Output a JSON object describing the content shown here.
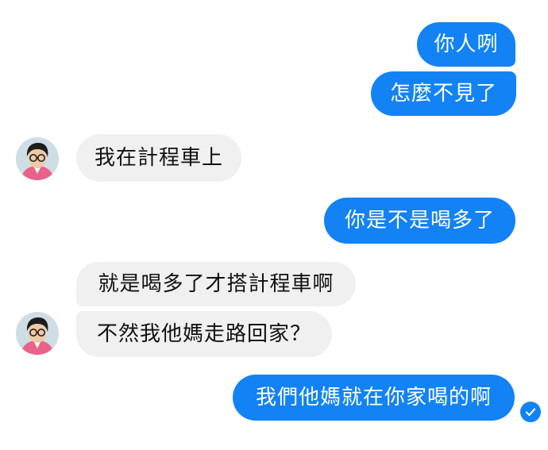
{
  "messages": [
    {
      "text": "你人咧"
    },
    {
      "text": "怎麼不見了"
    },
    {
      "text": "我在計程車上"
    },
    {
      "text": "你是不是喝多了"
    },
    {
      "text": "就是喝多了才搭計程車啊"
    },
    {
      "text": "不然我他媽走路回家？"
    },
    {
      "text": "我們他媽就在你家喝的啊"
    }
  ],
  "colors": {
    "outgoing_bubble": "#1282f5",
    "incoming_bubble": "#f1f0f0",
    "outgoing_text": "#ffffff",
    "incoming_text": "#111111"
  },
  "icons": {
    "avatar": "avatar",
    "read_receipt": "check-circle-icon"
  }
}
